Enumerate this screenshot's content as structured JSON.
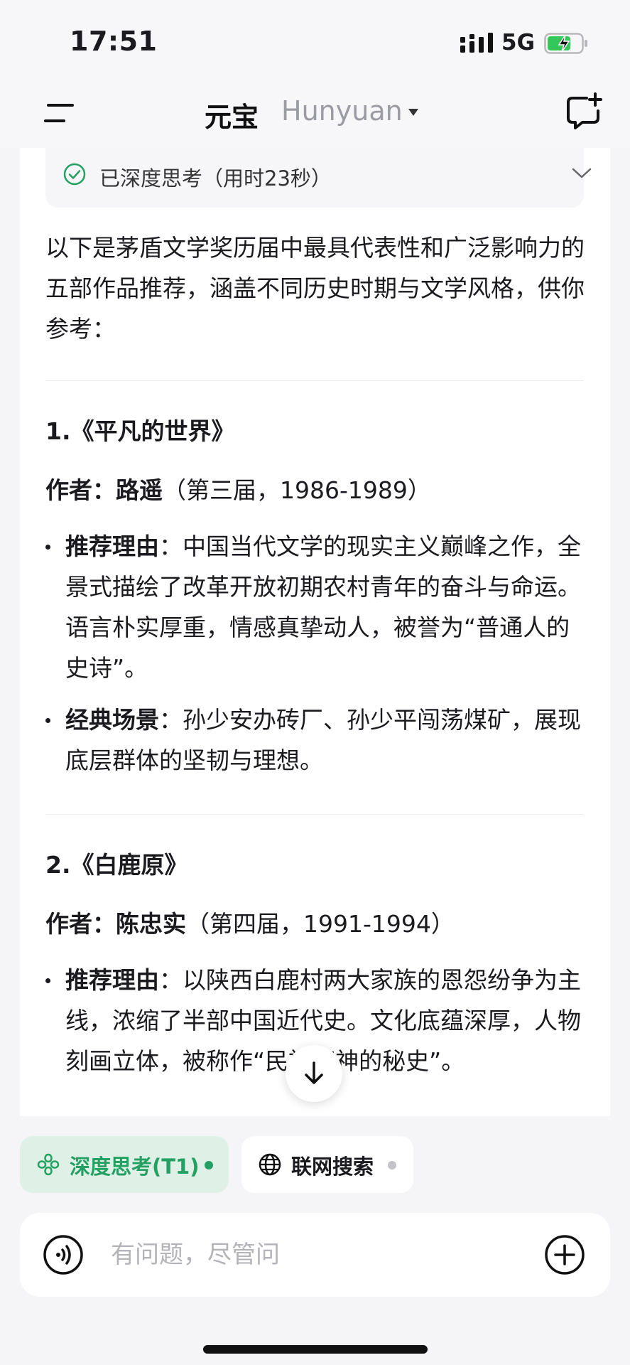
{
  "status_bar": {
    "time": "17:51",
    "network": "5G"
  },
  "nav": {
    "title": "元宝",
    "model": "Hunyuan"
  },
  "thinking": {
    "label": "已深度思考（用时23秒）"
  },
  "intro": "以下是茅盾文学奖历届中最具代表性和广泛影响力的五部作品推荐，涵盖不同历史时期与文学风格，供你参考：",
  "works": [
    {
      "title": "1.《平凡的世界》",
      "author_label": "作者：",
      "author_name": "路遥",
      "author_detail": "（第三届，1986-1989）",
      "bullets": [
        {
          "label": "推荐理由",
          "text": "：中国当代文学的现实主义巅峰之作，全景式描绘了改革开放初期农村青年的奋斗与命运。语言朴实厚重，情感真挚动人，被誉为“普通人的史诗”。"
        },
        {
          "label": "经典场景",
          "text": "：孙少安办砖厂、孙少平闯荡煤矿，展现底层群体的坚韧与理想。"
        }
      ]
    },
    {
      "title": "2.《白鹿原》",
      "author_label": "作者：",
      "author_name": "陈忠实",
      "author_detail": "（第四届，1991-1994）",
      "bullets": [
        {
          "label": "推荐理由",
          "text": "：以陕西白鹿村两大家族的恩怨纷争为主线，浓缩了半部中国近代史。文化底蕴深厚，人物刻画立体，被称作“民族精神的秘史”。"
        }
      ]
    }
  ],
  "chips": {
    "deep_think": "深度思考(T1)",
    "web_search": "联网搜索"
  },
  "input": {
    "placeholder": "有问题，尽管问"
  },
  "colors": {
    "accent_green": "#23a062",
    "chip_green_bg": "#dff1e6",
    "battery_green": "#34c759"
  }
}
